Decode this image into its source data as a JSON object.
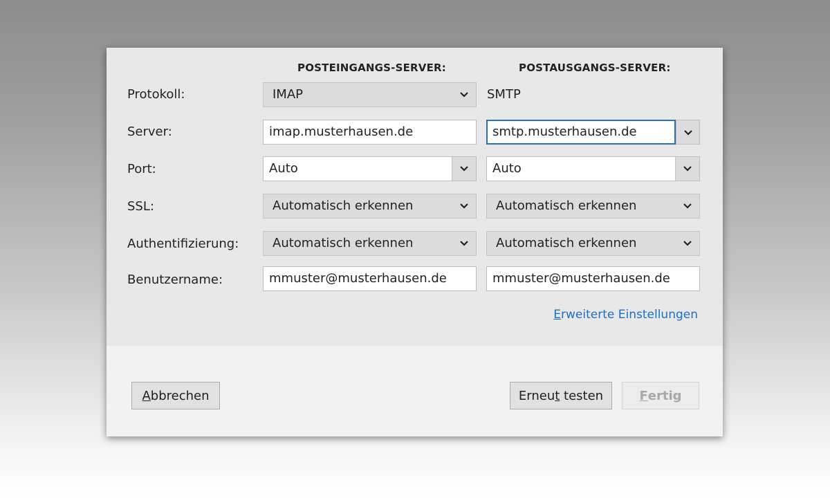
{
  "headers": {
    "incoming": "POSTEINGANGS-SERVER:",
    "outgoing": "POSTAUSGANGS-SERVER:"
  },
  "rows": {
    "protocol": {
      "label": "Protokoll:",
      "incoming": "IMAP",
      "outgoing": "SMTP"
    },
    "server": {
      "label": "Server:",
      "incoming": "imap.musterhausen.de",
      "outgoing": "smtp.musterhausen.de"
    },
    "port": {
      "label": "Port:",
      "incoming": "Auto",
      "outgoing": "Auto"
    },
    "ssl": {
      "label": "SSL:",
      "incoming": "Automatisch erkennen",
      "outgoing": "Automatisch erkennen"
    },
    "auth": {
      "label": "Authentifizierung:",
      "incoming": "Automatisch erkennen",
      "outgoing": "Automatisch erkennen"
    },
    "username": {
      "label": "Benutzername:",
      "incoming": "mmuster@musterhausen.de",
      "outgoing": "mmuster@musterhausen.de"
    }
  },
  "advanced_link": {
    "first": "E",
    "rest": "rweiterte Einstellungen"
  },
  "buttons": {
    "cancel": {
      "first": "A",
      "rest": "bbrechen"
    },
    "retest": {
      "before": "Erneu",
      "underlined": "t",
      "after": " testen"
    },
    "done": {
      "first": "F",
      "rest": "ertig"
    }
  },
  "icons": {
    "dropdown": "chevron-down-icon"
  },
  "colors": {
    "accent": "#1a6fc9",
    "focus_border": "#2a6fb8"
  }
}
